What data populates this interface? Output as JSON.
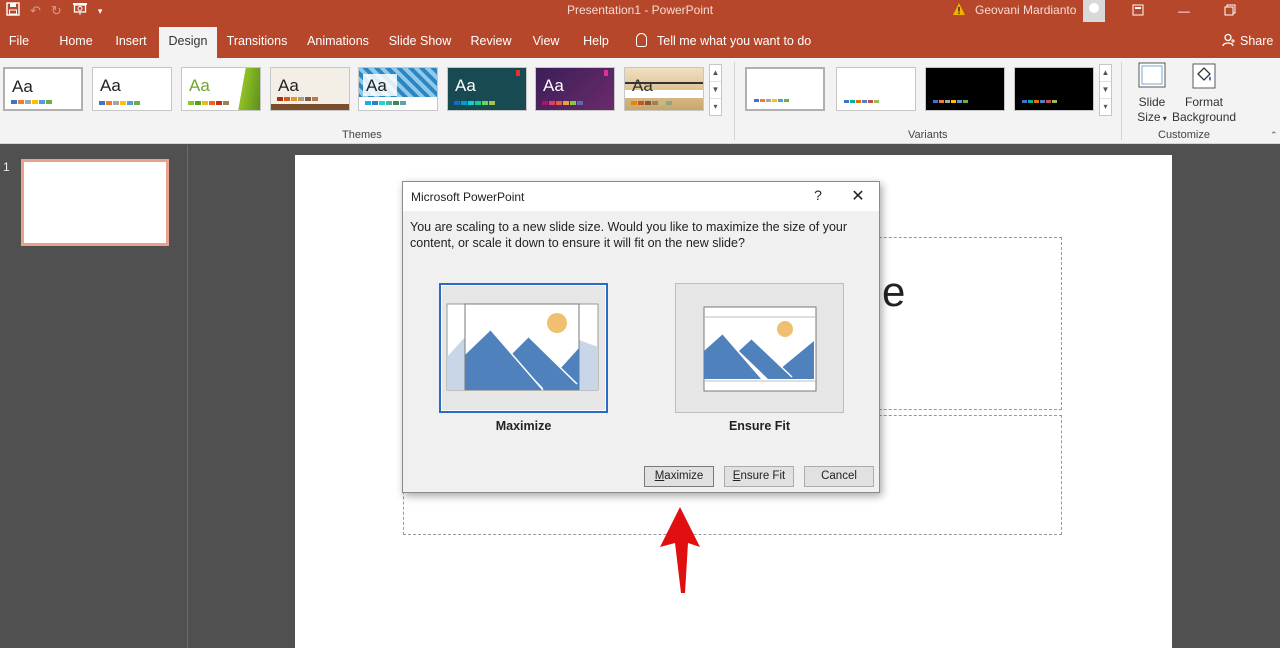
{
  "window": {
    "title": "Presentation1  -  PowerPoint",
    "user_name": "Geovani Mardianto",
    "warning_icon": "warning-icon",
    "controls": [
      "ribbon-display-icon",
      "minimize-icon",
      "restore-icon"
    ]
  },
  "quick_access": [
    "save-icon",
    "undo-icon",
    "redo-icon",
    "present-icon",
    "customize-icon"
  ],
  "tabs": [
    {
      "label": "File"
    },
    {
      "label": "Home"
    },
    {
      "label": "Insert"
    },
    {
      "label": "Design",
      "active": true
    },
    {
      "label": "Transitions"
    },
    {
      "label": "Animations"
    },
    {
      "label": "Slide Show"
    },
    {
      "label": "Review"
    },
    {
      "label": "View"
    },
    {
      "label": "Help"
    }
  ],
  "tell_me": "Tell me what you want to do",
  "share": "Share",
  "ribbon": {
    "themes_label": "Themes",
    "variants_label": "Variants",
    "customize_label": "Customize",
    "theme_sample_text": "Aa",
    "slide_size": {
      "line1": "Slide",
      "line2": "Size"
    },
    "format_background": {
      "line1": "Format",
      "line2": "Background"
    },
    "theme_colors": [
      "#ffffff",
      "#ffffff",
      "#ffffff",
      "#f4efe6",
      "#2c86c2",
      "#184a52",
      "#3a1f57",
      "#f2e0c2"
    ],
    "variant_colors": [
      "#ffffff",
      "#ffffff",
      "#000000",
      "#000000"
    ]
  },
  "slide_pane": {
    "slide_number": "1"
  },
  "slide": {
    "visible_char": "e"
  },
  "dialog": {
    "title": "Microsoft PowerPoint",
    "help": "?",
    "close": "✕",
    "message": "You are scaling to a new slide size.  Would you like to maximize the size of your content, or scale it down to ensure it will fit on the new slide?",
    "option_maximize": "Maximize",
    "option_ensure_fit": "Ensure Fit",
    "buttons": {
      "maximize": {
        "accel": "M",
        "rest": "aximize"
      },
      "ensure_fit": {
        "accel": "E",
        "rest": "nsure Fit"
      },
      "cancel": "Cancel"
    }
  },
  "colors": {
    "accent": "#b7472a",
    "annotation_arrow": "#e01010",
    "focus": "#2a6cc4"
  }
}
